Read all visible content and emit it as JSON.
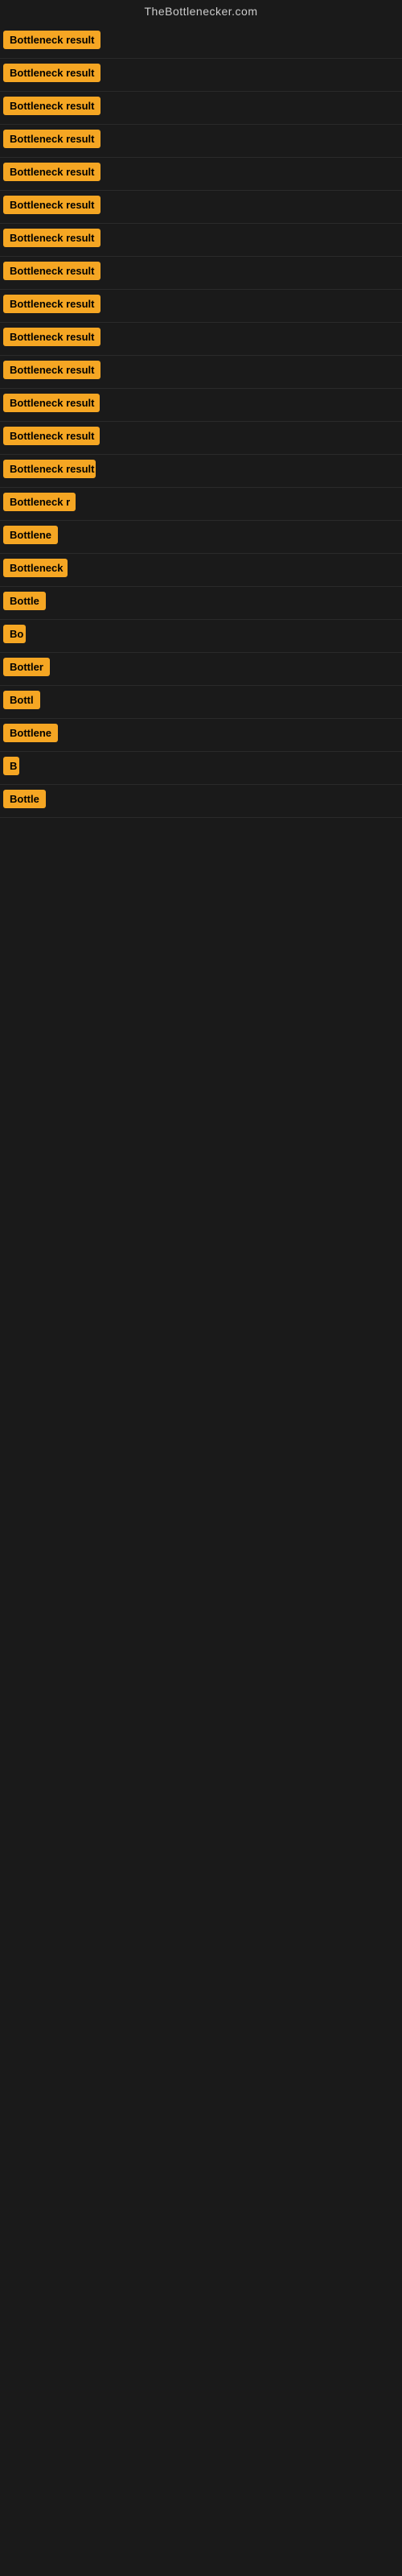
{
  "site": {
    "title": "TheBottlenecker.com"
  },
  "rows": [
    {
      "id": 1,
      "label": "Bottleneck result",
      "width": 130
    },
    {
      "id": 2,
      "label": "Bottleneck result",
      "width": 130
    },
    {
      "id": 3,
      "label": "Bottleneck result",
      "width": 130
    },
    {
      "id": 4,
      "label": "Bottleneck result",
      "width": 130
    },
    {
      "id": 5,
      "label": "Bottleneck result",
      "width": 130
    },
    {
      "id": 6,
      "label": "Bottleneck result",
      "width": 130
    },
    {
      "id": 7,
      "label": "Bottleneck result",
      "width": 130
    },
    {
      "id": 8,
      "label": "Bottleneck result",
      "width": 130
    },
    {
      "id": 9,
      "label": "Bottleneck result",
      "width": 130
    },
    {
      "id": 10,
      "label": "Bottleneck result",
      "width": 130
    },
    {
      "id": 11,
      "label": "Bottleneck result",
      "width": 130
    },
    {
      "id": 12,
      "label": "Bottleneck result",
      "width": 120
    },
    {
      "id": 13,
      "label": "Bottleneck result",
      "width": 120
    },
    {
      "id": 14,
      "label": "Bottleneck result",
      "width": 115
    },
    {
      "id": 15,
      "label": "Bottleneck r",
      "width": 90
    },
    {
      "id": 16,
      "label": "Bottlene",
      "width": 70
    },
    {
      "id": 17,
      "label": "Bottleneck",
      "width": 80
    },
    {
      "id": 18,
      "label": "Bottle",
      "width": 55
    },
    {
      "id": 19,
      "label": "Bo",
      "width": 28
    },
    {
      "id": 20,
      "label": "Bottler",
      "width": 58
    },
    {
      "id": 21,
      "label": "Bottl",
      "width": 48
    },
    {
      "id": 22,
      "label": "Bottlene",
      "width": 68
    },
    {
      "id": 23,
      "label": "B",
      "width": 20
    },
    {
      "id": 24,
      "label": "Bottle",
      "width": 55
    }
  ]
}
